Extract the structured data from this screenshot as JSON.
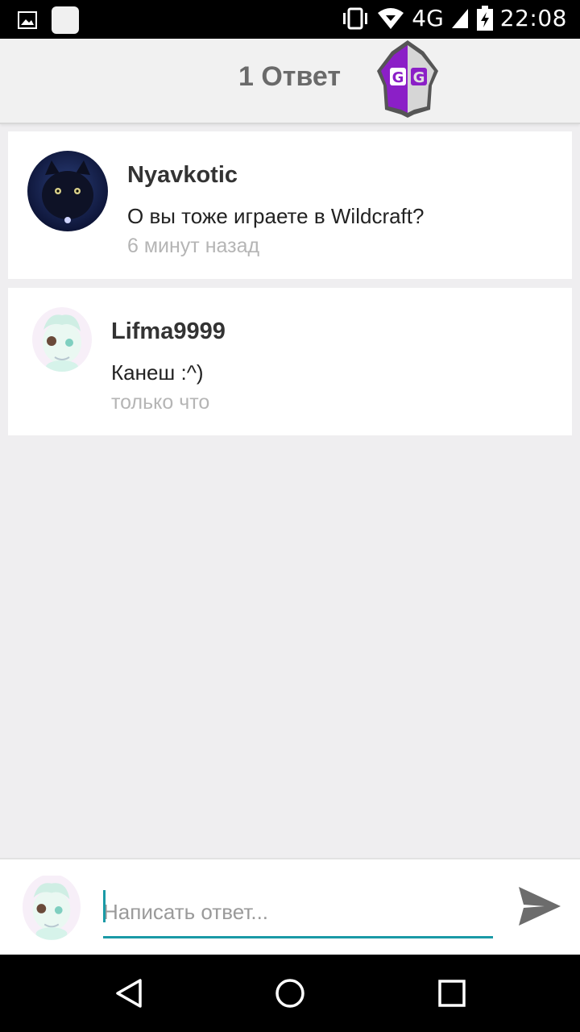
{
  "status_bar": {
    "time": "22:08",
    "network": "4G",
    "icons": [
      "gallery-icon",
      "notification-square-icon",
      "vibrate-icon",
      "wifi-icon",
      "signal-icon",
      "battery-charging-icon"
    ]
  },
  "header": {
    "title": "1 Ответ",
    "logo": "gameguardian-logo"
  },
  "comments": [
    {
      "user": "Nyavkotic",
      "text": "О вы тоже играете в Wildcraft?",
      "time": "6 минут назад",
      "avatar": "black-cat-avatar"
    },
    {
      "user": "Lifma9999",
      "text": "Канеш :^)",
      "time": "только что",
      "avatar": "anime-character-avatar"
    }
  ],
  "reply": {
    "placeholder": "Написать ответ...",
    "value": "",
    "send_icon": "send-icon"
  },
  "nav": {
    "icons": [
      "back-icon",
      "home-icon",
      "recents-icon"
    ]
  },
  "colors": {
    "accent": "#1a9aa6",
    "background": "#efeef0",
    "logo_purple": "#8b1fc7"
  }
}
